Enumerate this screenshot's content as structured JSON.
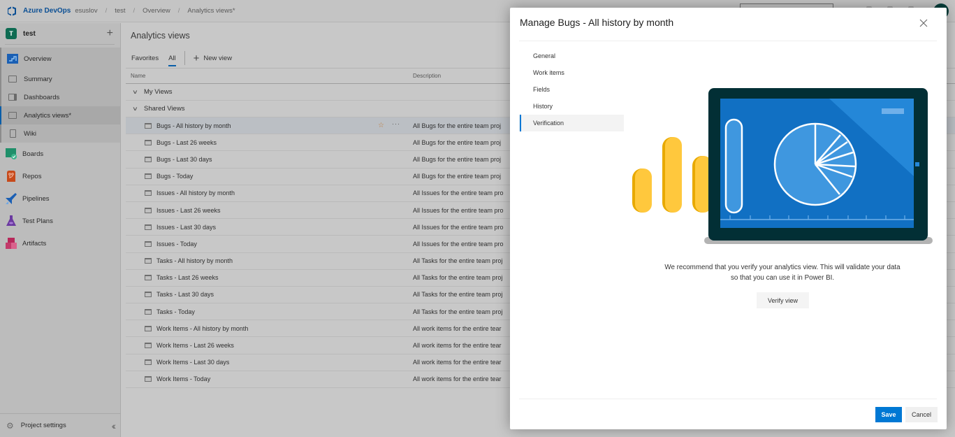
{
  "topbar": {
    "brand": "Azure DevOps",
    "breadcrumb": [
      "esuslov",
      "test",
      "Overview",
      "Analytics views*"
    ]
  },
  "sidebar": {
    "project": {
      "initial": "T",
      "name": "test",
      "color": "#0e6b52"
    },
    "overview": "Overview",
    "sub_items": [
      {
        "label": "Summary",
        "icon": "summary-icon"
      },
      {
        "label": "Dashboards",
        "icon": "dashboards-icon"
      },
      {
        "label": "Analytics views*",
        "icon": "analytics-views-icon",
        "active": true
      },
      {
        "label": "Wiki",
        "icon": "wiki-icon"
      }
    ],
    "hubs": [
      {
        "label": "Boards",
        "icon": "boards-icon",
        "color": "#1f8f6a"
      },
      {
        "label": "Repos",
        "icon": "repos-icon",
        "color": "#c74a1b"
      },
      {
        "label": "Pipelines",
        "icon": "pipelines-icon",
        "color": "#1a5fb4"
      },
      {
        "label": "Test Plans",
        "icon": "test-plans-icon",
        "color": "#6b3aa0"
      },
      {
        "label": "Artifacts",
        "icon": "artifacts-icon",
        "color": "#b7285a"
      }
    ],
    "footer": "Project settings"
  },
  "main": {
    "title": "Analytics views",
    "pivots": [
      "Favorites",
      "All"
    ],
    "selected_pivot": "All",
    "new_view": "New view",
    "columns": {
      "name": "Name",
      "description": "Description"
    },
    "groups": [
      "My Views",
      "Shared Views"
    ],
    "rows": [
      {
        "name": "Bugs - All history by month",
        "description": "All Bugs for the entire team proj"
      },
      {
        "name": "Bugs - Last 26 weeks",
        "description": "All Bugs for the entire team proj"
      },
      {
        "name": "Bugs - Last 30 days",
        "description": "All Bugs for the entire team proj"
      },
      {
        "name": "Bugs - Today",
        "description": "All Bugs for the entire team proj"
      },
      {
        "name": "Issues - All history by month",
        "description": "All Issues for the entire team pro"
      },
      {
        "name": "Issues - Last 26 weeks",
        "description": "All Issues for the entire team pro"
      },
      {
        "name": "Issues - Last 30 days",
        "description": "All Issues for the entire team pro"
      },
      {
        "name": "Issues - Today",
        "description": "All Issues for the entire team pro"
      },
      {
        "name": "Tasks - All history by month",
        "description": "All Tasks for the entire team proj"
      },
      {
        "name": "Tasks - Last 26 weeks",
        "description": "All Tasks for the entire team proj"
      },
      {
        "name": "Tasks - Last 30 days",
        "description": "All Tasks for the entire team proj"
      },
      {
        "name": "Tasks - Today",
        "description": "All Tasks for the entire team proj"
      },
      {
        "name": "Work Items - All history by month",
        "description": "All work items for the entire tear"
      },
      {
        "name": "Work Items - Last 26 weeks",
        "description": "All work items for the entire tear"
      },
      {
        "name": "Work Items - Last 30 days",
        "description": "All work items for the entire tear"
      },
      {
        "name": "Work Items - Today",
        "description": "All work items for the entire tear"
      }
    ]
  },
  "dialog": {
    "title": "Manage Bugs - All history by month",
    "nav": [
      "General",
      "Work items",
      "Fields",
      "History",
      "Verification"
    ],
    "selected_nav": "Verification",
    "message": "We recommend that you verify your analytics view. This will validate your data so that you can use it in Power BI.",
    "verify_button": "Verify view",
    "save_button": "Save",
    "cancel_button": "Cancel",
    "accent_color": "#0078d4"
  }
}
